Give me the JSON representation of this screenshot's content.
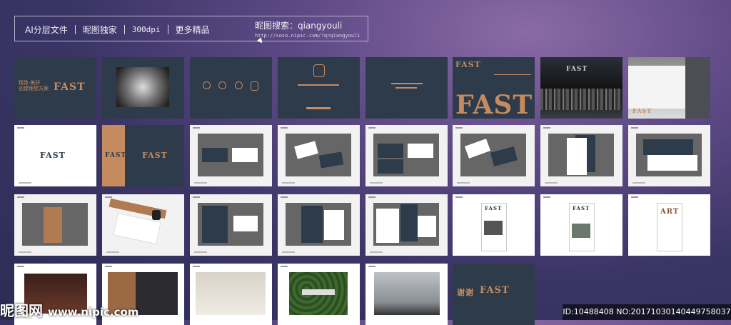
{
  "header": {
    "items": [
      "AI分层文件",
      "昵图独家",
      "300dpi",
      "更多精品"
    ],
    "search_title": "昵图搜索：qiangyouli",
    "search_url": "http://soso.nipic.com/?q=qiangyouli"
  },
  "thumbnails": {
    "logo_text": "FAST",
    "thanks_text": "谢谢",
    "slogan": "精致·美好\n创建理想方案",
    "art_text": "ART"
  },
  "watermark": {
    "brand": "昵图网",
    "url": "www.nipic.com"
  },
  "image_id": "ID:10488408 NO:20171030140449758037",
  "colors": {
    "accent": "#c68a5f",
    "navy": "#2d3b4a",
    "gray": "#666666"
  }
}
